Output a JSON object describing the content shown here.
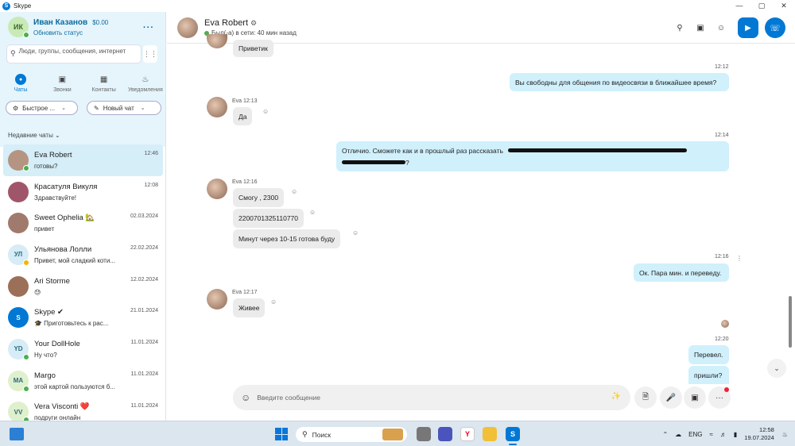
{
  "window": {
    "title": "Skype",
    "logo_letter": "S",
    "minimize": "—",
    "maximize": "▢",
    "close": "✕"
  },
  "profile": {
    "initials": "ИК",
    "name": "Иван Казанов",
    "balance": "$0.00",
    "status_link": "Обновить статус",
    "more": "···"
  },
  "search": {
    "placeholder": "Люди, группы, сообщения, интернет"
  },
  "nav": [
    {
      "label": "Чаты",
      "icon": "chat-icon"
    },
    {
      "label": "Звонки",
      "icon": "video-icon"
    },
    {
      "label": "Контакты",
      "icon": "contacts-icon"
    },
    {
      "label": "Уведомления",
      "icon": "bell-icon"
    }
  ],
  "quick": {
    "meet": "Быстрое ...",
    "new_chat": "Новый чат"
  },
  "recent_header": "Недавние чаты ⌄",
  "chats": [
    {
      "name": "Eva Robert",
      "last": "готовы?",
      "date": "12:46",
      "presence": "online",
      "avatar_bg": "#b69482",
      "initials": ""
    },
    {
      "name": "Красатуля Викуля",
      "last": "Здравствуйте!",
      "date": "12:08",
      "presence": "",
      "avatar_bg": "#a0566a",
      "initials": ""
    },
    {
      "name": "Sweet Ophelia 🏡",
      "last": "привет",
      "date": "02.03.2024",
      "presence": "",
      "avatar_bg": "#a07b6d",
      "initials": ""
    },
    {
      "name": "Ульянова Лолли",
      "last": "Привет, мой сладкий коти...",
      "date": "22.02.2024",
      "presence": "away",
      "avatar_bg": "#d6ecf6",
      "initials": "УЛ"
    },
    {
      "name": "Ari Storme",
      "last": "😓",
      "date": "12.02.2024",
      "presence": "",
      "avatar_bg": "#9b6f58",
      "initials": ""
    },
    {
      "name": "Skype ✔",
      "last": "🎓 Приготовьтесь к рас...",
      "date": "21.01.2024",
      "presence": "",
      "avatar_bg": "#0078d4",
      "initials": "S"
    },
    {
      "name": "Your DollHole",
      "last": "Ну что?",
      "date": "11.01.2024",
      "presence": "online",
      "avatar_bg": "#d6ecf6",
      "initials": "YD"
    },
    {
      "name": "Margo",
      "last": "этой картой пользуются б...",
      "date": "11.01.2024",
      "presence": "online",
      "avatar_bg": "#dff0cd",
      "initials": "MA"
    },
    {
      "name": "Vera Visconti ❤️",
      "last": "подруги онлайн",
      "date": "11.01.2024",
      "presence": "online",
      "avatar_bg": "#dff0cd",
      "initials": "VV"
    }
  ],
  "header": {
    "name": "Eva Robert",
    "status": "Был(-а) в сети: 40 мин назад"
  },
  "messages": {
    "m0": "Приветик",
    "t1": "12:12",
    "m1": "Вы свободны для общения по видеосвязи в ближайшее время?",
    "meta2": "Eva 12:13",
    "m2": "Да",
    "t3": "12:14",
    "m3a": "Отличио. Сможете как и в прошлый раз рассказать",
    "m3b": "?",
    "meta4": "Eva 12:16",
    "m4": "Смогу , 2300",
    "m5": "2200701325110770",
    "m6": "Минут через 10-15 готова буду",
    "t7": "12:16",
    "m7": "Ок. Пара мин. и переведу.",
    "meta8": "Eva 12:17",
    "m8": "Живее",
    "t9": "12:20",
    "m9": "Перевел.",
    "m10": "пришли?"
  },
  "composer": {
    "placeholder": "Введите сообщение"
  },
  "taskbar": {
    "search": "Поиск",
    "lang": "ENG",
    "time": "12:58",
    "date": "19.07.2024"
  },
  "colors": {
    "accent": "#0078d4",
    "sidebar_bg": "#e5f5fb",
    "bubble_out": "#d0f0fc",
    "bubble_in": "#ebebeb",
    "online": "#4caf50"
  }
}
